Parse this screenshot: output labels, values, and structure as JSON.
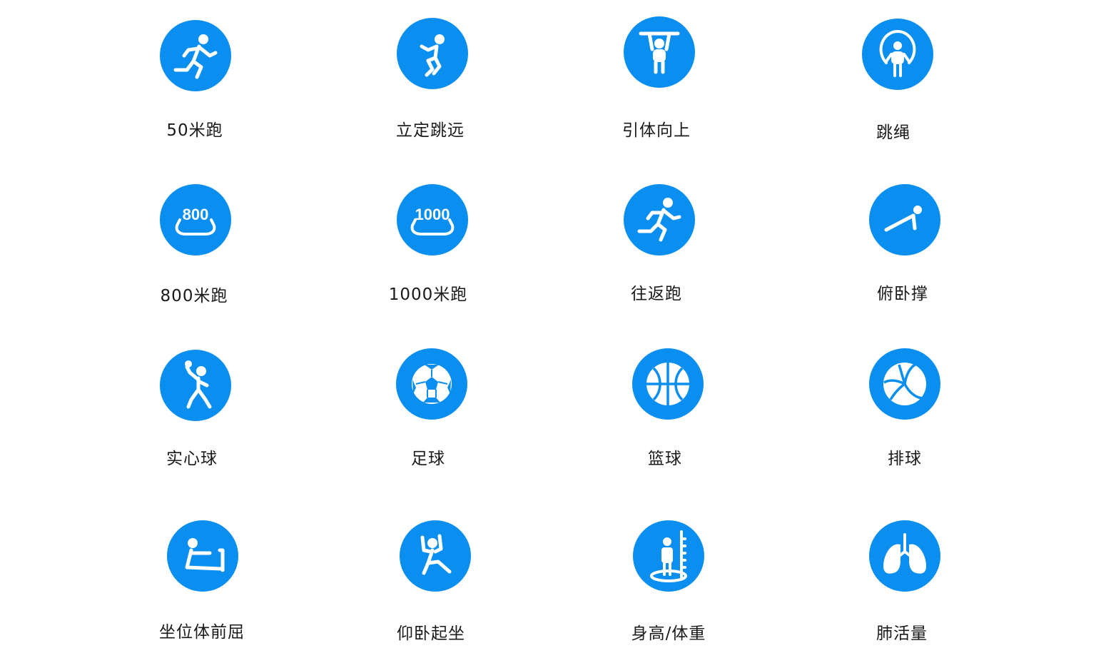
{
  "tests": [
    {
      "label": "50米跑",
      "icon": "sprint-runner-icon"
    },
    {
      "label": "立定跳远",
      "icon": "standing-jump-icon"
    },
    {
      "label": "引体向上",
      "icon": "pull-up-icon"
    },
    {
      "label": "跳绳",
      "icon": "jump-rope-icon"
    },
    {
      "label": "800米跑",
      "icon": "track-800-icon",
      "badge": "800"
    },
    {
      "label": "1000米跑",
      "icon": "track-1000-icon",
      "badge": "1000"
    },
    {
      "label": "往返跑",
      "icon": "shuttle-run-icon"
    },
    {
      "label": "俯卧撑",
      "icon": "push-up-icon"
    },
    {
      "label": "实心球",
      "icon": "medicine-ball-throw-icon"
    },
    {
      "label": "足球",
      "icon": "soccer-ball-icon"
    },
    {
      "label": "篮球",
      "icon": "basketball-icon"
    },
    {
      "label": "排球",
      "icon": "volleyball-icon"
    },
    {
      "label": "坐位体前屈",
      "icon": "sit-and-reach-icon"
    },
    {
      "label": "仰卧起坐",
      "icon": "sit-up-icon"
    },
    {
      "label": "身高/体重",
      "icon": "height-weight-icon"
    },
    {
      "label": "肺活量",
      "icon": "lungs-icon"
    }
  ],
  "colors": {
    "icon_bg": "#0a8ff0",
    "icon_fg": "#ffffff",
    "label": "#1a1a1a"
  }
}
